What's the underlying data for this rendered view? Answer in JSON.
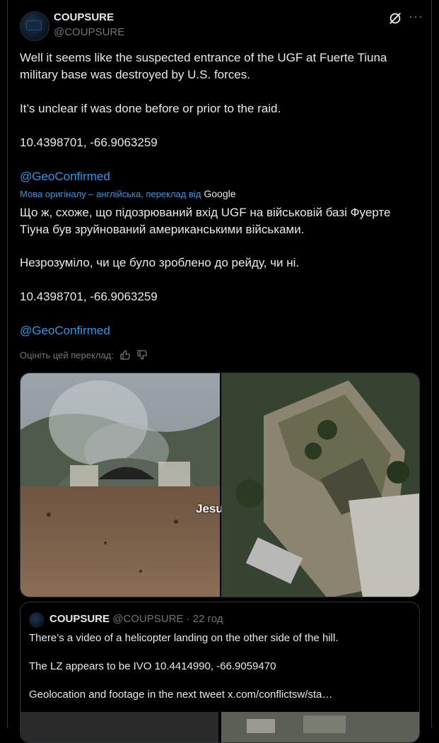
{
  "author": {
    "display_name": "COUPSURE",
    "handle": "@COUPSURE"
  },
  "post": {
    "original": {
      "line1": "Well it seems like the suspected entrance of the UGF at Fuerte Tiuna military base was destroyed by U.S. forces.",
      "line2": "It’s unclear if was done before or prior to the raid.",
      "coords": "10.4398701, -66.9063259",
      "mention": "@GeoConfirmed"
    },
    "translation_note": "Мова оригіналу – англійська, переклад від",
    "translation_provider": "Google",
    "translated": {
      "line1": "Що ж, схоже, що підозрюваний вхід UGF на військовій базі Фуерте Тіуна був зруйнований американськими військами.",
      "line2": "Незрозуміло, чи це було зроблено до рейду, чи ні.",
      "coords": "10.4398701, -66.9063259",
      "mention": "@GeoConfirmed"
    },
    "rate_label": "Оцініть цей переклад:",
    "image_overlay_text": "Jesu"
  },
  "quote": {
    "display_name": "COUPSURE",
    "handle": "@COUPSURE",
    "time": "· 22 год",
    "line1": "There’s a video of a helicopter landing on the other side of the hill.",
    "line2": "The LZ appears to be IVO 10.4414990, -66.9059470",
    "line3": "Geolocation and footage in the next tweet  x.com/conflictsw/sta…"
  },
  "colors": {
    "background": "#000000",
    "text": "#e7e9ea",
    "secondary": "#71767b",
    "link": "#1d9bf0",
    "border": "#2f3336"
  },
  "icons": [
    "grok-icon",
    "more-icon",
    "thumbs-up-icon",
    "thumbs-down-icon"
  ]
}
